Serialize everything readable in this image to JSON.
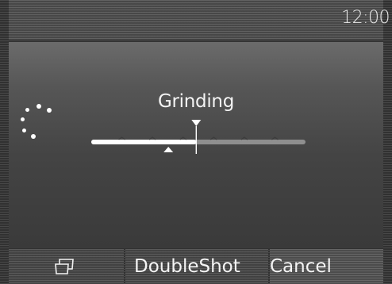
{
  "status_bar": {
    "time": "12:00"
  },
  "main": {
    "title": "Grinding",
    "spinner_icon": "loading-spinner-icon",
    "progress": {
      "fraction": 0.49,
      "segments": 7,
      "target_marker_fraction": 0.49,
      "current_marker_fraction": 0.36
    }
  },
  "soft_keys": {
    "cup_icon": "cup-icon",
    "double_shot_label": "DoubleShot",
    "cancel_label": "Cancel"
  },
  "colors": {
    "progress_filled": "#ffffff",
    "progress_empty": "#8f8f8f",
    "panel_background": "#3a3a3a"
  }
}
